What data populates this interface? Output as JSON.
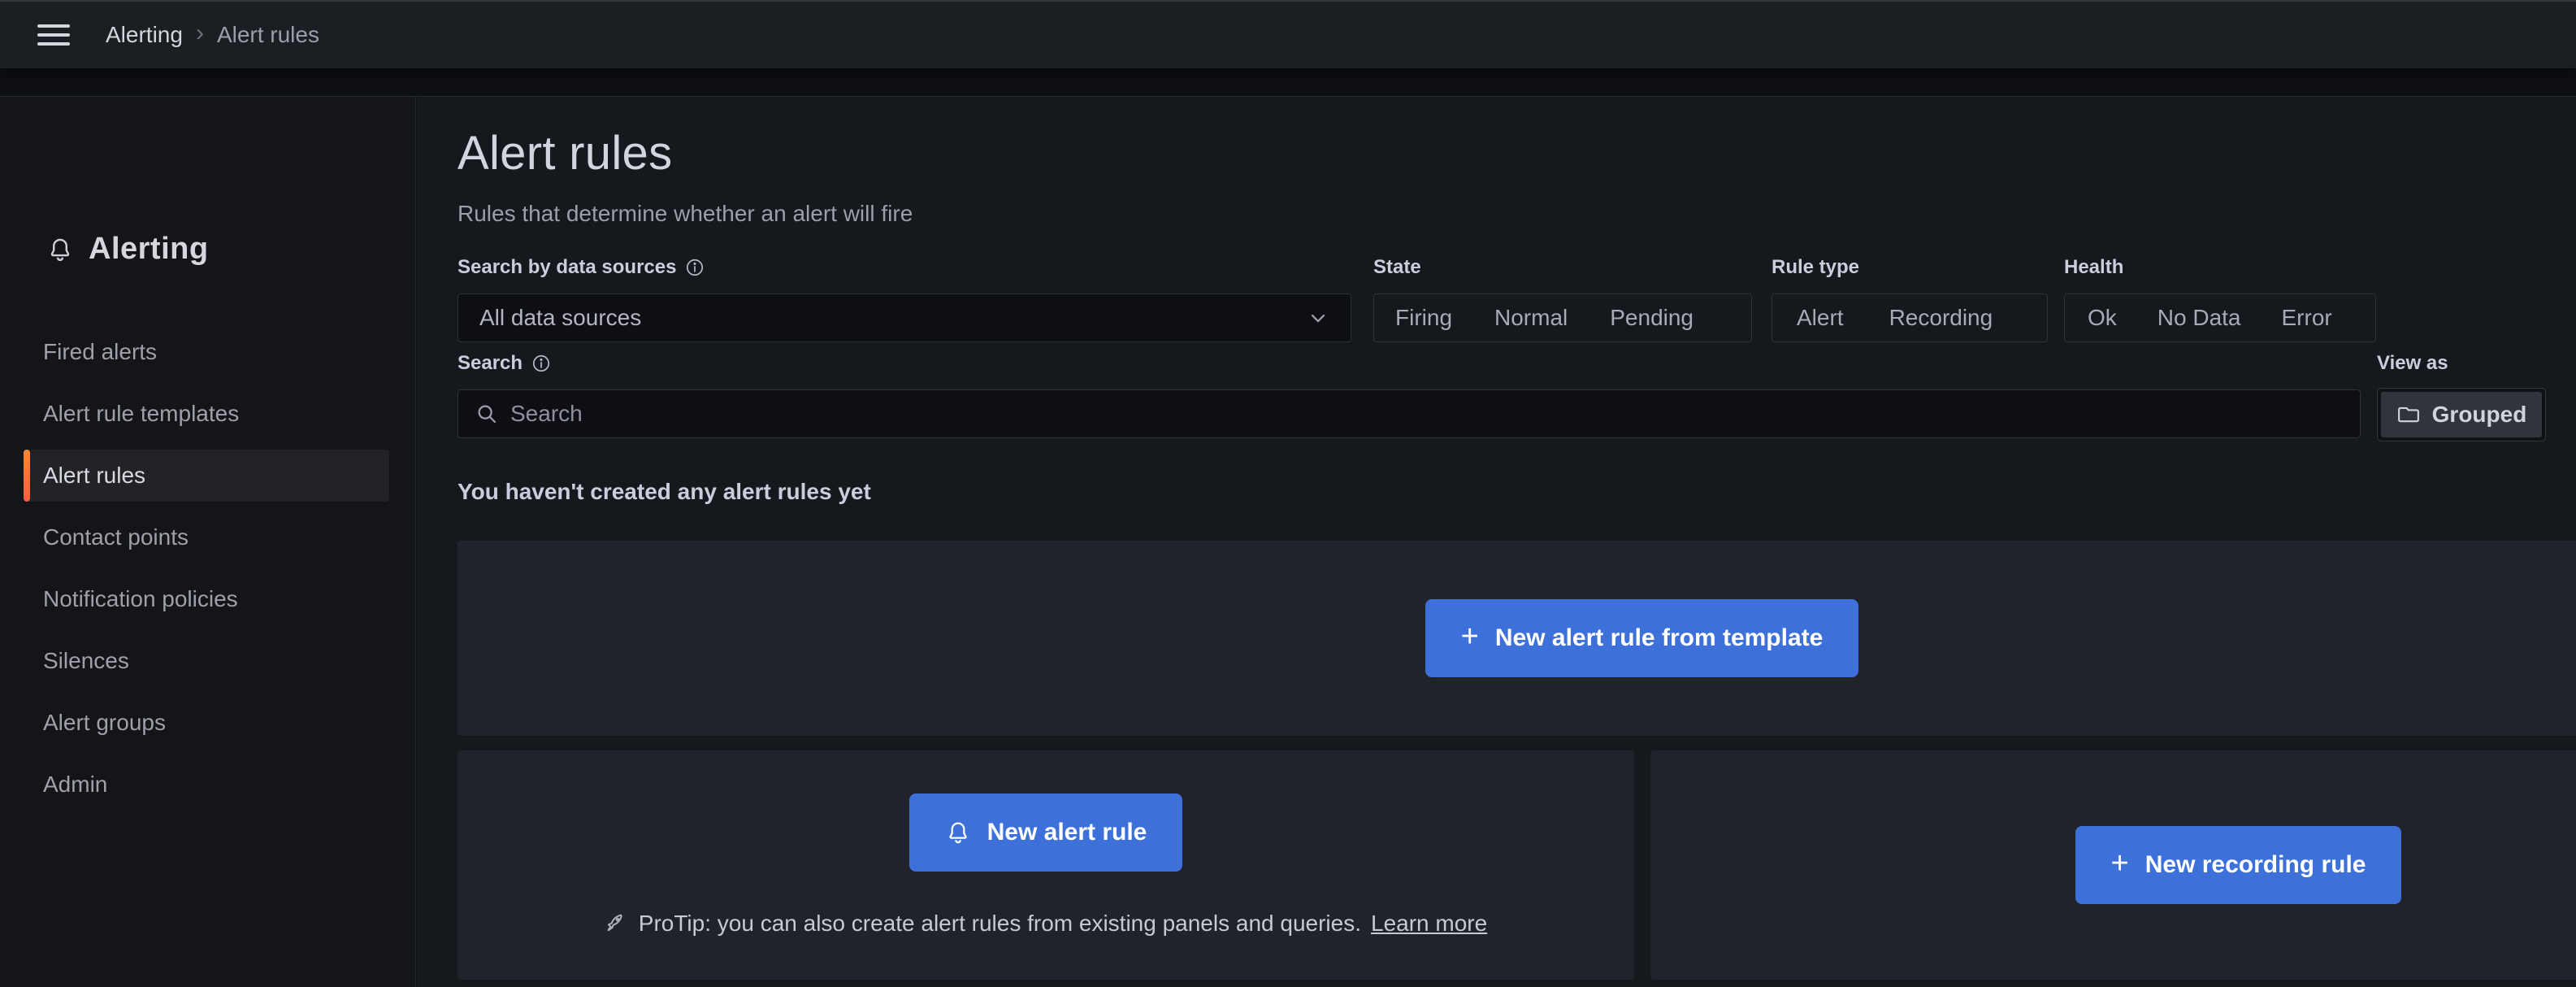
{
  "header": {
    "breadcrumb": {
      "section": "Alerting",
      "page": "Alert rules"
    }
  },
  "sidebar": {
    "title": "Alerting",
    "items": [
      {
        "label": "Fired alerts",
        "active": false
      },
      {
        "label": "Alert rule templates",
        "active": false
      },
      {
        "label": "Alert rules",
        "active": true
      },
      {
        "label": "Contact points",
        "active": false
      },
      {
        "label": "Notification policies",
        "active": false
      },
      {
        "label": "Silences",
        "active": false
      },
      {
        "label": "Alert groups",
        "active": false
      },
      {
        "label": "Admin",
        "active": false
      }
    ]
  },
  "main": {
    "title": "Alert rules",
    "subtitle": "Rules that determine whether an alert will fire",
    "filters": {
      "data_source": {
        "label": "Search by data sources",
        "value": "All data sources"
      },
      "state": {
        "label": "State",
        "options": [
          "Firing",
          "Normal",
          "Pending"
        ]
      },
      "rule_type": {
        "label": "Rule type",
        "options": [
          "Alert",
          "Recording"
        ]
      },
      "health": {
        "label": "Health",
        "options": [
          "Ok",
          "No Data",
          "Error"
        ]
      },
      "search": {
        "label": "Search",
        "placeholder": "Search"
      },
      "view_as": {
        "label": "View as",
        "value": "Grouped"
      }
    },
    "empty_state": {
      "message": "You haven't created any alert rules yet",
      "template_button": "New alert rule from template",
      "new_alert_button": "New alert rule",
      "protip_text": "ProTip: you can also create alert rules from existing panels and queries.",
      "protip_link": "Learn more",
      "new_recording_button": "New recording rule"
    }
  },
  "colors": {
    "accent_blue": "#3d71d9",
    "active_item_bar_top": "#ff8833",
    "active_item_bar_bottom": "#f55f3e",
    "panel_background": "#20232a",
    "page_background": "#15181d",
    "text_primary": "#ccccdc",
    "text_secondary": "#9d9ea8"
  }
}
